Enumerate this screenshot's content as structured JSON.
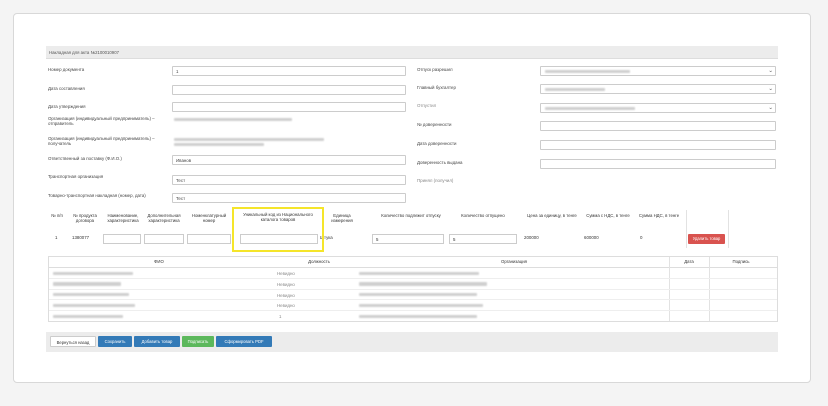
{
  "header": {
    "title": "Накладная для акта №2100010907"
  },
  "left_labels": {
    "doc_number": "Номер документа",
    "date_created": "Дата составления",
    "date_approved": "Дата утверждения",
    "org_sender": "Организация (индивидуальный предприниматель) – отправитель",
    "org_receiver": "Организация (индивидуальный предприниматель) – получатель",
    "responsible": "Ответственный за поставку (Ф.И.О.)",
    "transport_org": "Транспортная организация",
    "waybill": "Товарно-транспортная накладная (номер, дата)"
  },
  "left_values": {
    "doc_number": "1",
    "responsible": "Иванов",
    "transport_org": "Тест",
    "waybill": "Тест"
  },
  "right_labels": {
    "released_by": "Отпуск разрешил",
    "chief_accountant": "Главный бухгалтер",
    "released": "Отпустил",
    "poa_number": "№ доверенности",
    "poa_date": "Дата доверенности",
    "poa_issued": "Доверенность выдана",
    "received": "Принял (получил)"
  },
  "goods_table": {
    "headers": [
      "№ п/п",
      "№ продукта договора",
      "Наименование, характеристика",
      "Дополнительная характеристика",
      "Номенклатурный номер",
      "Уникальный код из Национального каталога товаров",
      "Единица измерения",
      "Количество подлежит отпуску",
      "Количество отпущено",
      "Цена за единицу, в тенге",
      "Сумма с НДС, в тенге",
      "Сумма НДС, в тенге"
    ],
    "row": {
      "num": "1",
      "product_num": "1380077",
      "unit": "Штука",
      "qty_to_release": "5",
      "qty_released": "5",
      "price": "200000",
      "sum_vat": "600000",
      "vat": "0"
    },
    "delete_label": "Удалить товар"
  },
  "sign_table": {
    "headers": [
      "ФИО",
      "Должность",
      "Организация",
      "Дата",
      "Подпись"
    ],
    "positions": [
      "Невидно",
      "Невидно",
      "Невидно",
      "Невидно",
      "1"
    ]
  },
  "footer": {
    "back": "Вернуться назад",
    "save": "Сохранить",
    "add_item": "Добавить товар",
    "sign": "Подписать",
    "pdf": "Сформировать PDF"
  },
  "colors": {
    "primary": "#337ab7",
    "success": "#5cb85c",
    "danger": "#d9534f",
    "highlight": "#f5e52a"
  }
}
